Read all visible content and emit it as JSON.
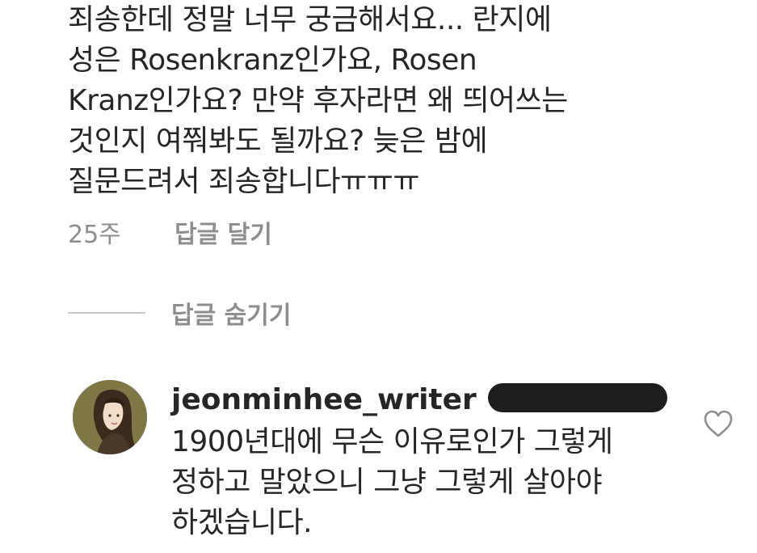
{
  "comment": {
    "lines": [
      "죄송한데 정말 너무 궁금해서요... 란지에",
      "성은 Rosenkranz인가요, Rosen",
      "Kranz인가요? 만약 후자라면 왜 띄어쓰는",
      "것인지 여쭤봐도 될까요? 늦은 밤에",
      "질문드려서 죄송합니다ㅠㅠㅠ"
    ],
    "time": "25주",
    "reply_label": "답글 달기"
  },
  "replies_toggle": {
    "label": "답글 숨기기"
  },
  "reply": {
    "username": "jeonminhee_writer",
    "lines": [
      "1900년대에 무슨 이유로인가 그렇게",
      "정하고 말았으니 그냥 그렇게 살아야",
      "하겠습니다."
    ],
    "like_icon": "heart-outline-icon"
  },
  "colors": {
    "text": "#262626",
    "muted": "#8e8e8e",
    "divider": "#c7c7c7",
    "redaction": "#1e1e1e"
  }
}
